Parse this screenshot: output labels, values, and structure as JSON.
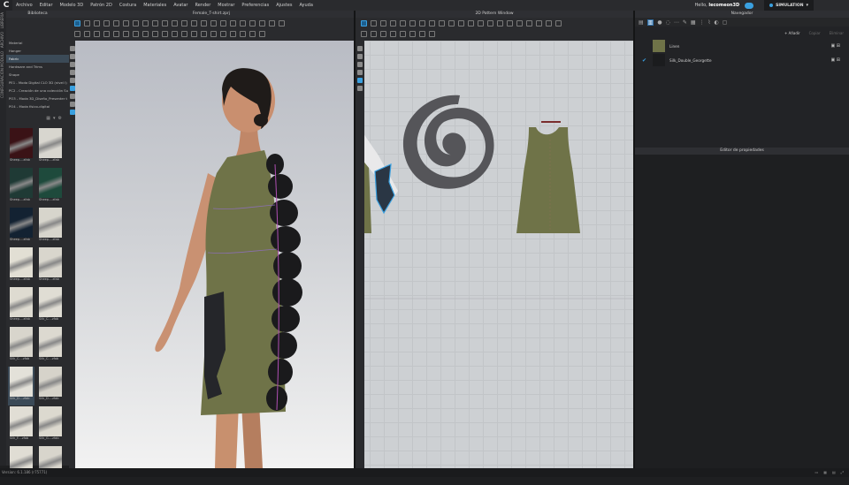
{
  "menubar": {
    "logo": "C",
    "items": [
      "Archivo",
      "Editar",
      "Modelo 3D",
      "Patrón 2D",
      "Costura",
      "Materiales",
      "Avatar",
      "Render",
      "Mostrar",
      "Preferencias",
      "Ajustes",
      "Ayuda"
    ],
    "user_prefix": "Hello,",
    "user_name": "lecomeon3D",
    "mode": "SIMULATION"
  },
  "vertical_tabs": [
    "LIBRERÍA",
    "ARCHIVO",
    "CONFIGURACIÓN MÓDULO"
  ],
  "library": {
    "title": "Biblioteca",
    "folders": [
      {
        "label": "Material",
        "selected": false
      },
      {
        "label": "Hanger",
        "selected": false
      },
      {
        "label": "Fabric",
        "selected": true
      },
      {
        "label": "Hardware and Trims",
        "selected": false
      },
      {
        "label": "Shape",
        "selected": false
      },
      {
        "label": "PE1 - Moda Digital CLO 3D (nivel I)",
        "selected": false
      },
      {
        "label": "PC2 - Creación de una colección Su",
        "selected": false
      },
      {
        "label": "PO3 - Moda 3D_Diseño_Presenter t",
        "selected": false
      },
      {
        "label": "PO4 - Moda físico-digital",
        "selected": false
      }
    ],
    "thumbnails": [
      {
        "label": "Sheep....zfab",
        "color": "#3a1216",
        "selected": false
      },
      {
        "label": "Sheep....zfab",
        "color": "#d8d6cf",
        "selected": false
      },
      {
        "label": "Sheep....zfab",
        "color": "#1f3a35",
        "selected": false
      },
      {
        "label": "Sheep....zfab",
        "color": "#1e4a3c",
        "selected": false
      },
      {
        "label": "Sheep....zfab",
        "color": "#132232",
        "selected": false
      },
      {
        "label": "Sheep....zfab",
        "color": "#d7d5cc",
        "selected": false
      },
      {
        "label": "Sheep....zfab",
        "color": "#e2dfd4",
        "selected": false
      },
      {
        "label": "Sheep....zfab",
        "color": "#d9d6cd",
        "selected": false
      },
      {
        "label": "Sheep....zfab",
        "color": "#dedbd1",
        "selected": false
      },
      {
        "label": "Silk_C....zfab",
        "color": "#e0ddd4",
        "selected": false
      },
      {
        "label": "Silk_C....zfab",
        "color": "#d8d5cc",
        "selected": false
      },
      {
        "label": "Silk_C....zfab",
        "color": "#dcd9d0",
        "selected": false
      },
      {
        "label": "Silk_D....zfab",
        "color": "#e3e1d9",
        "selected": true
      },
      {
        "label": "Silk_D....zfab",
        "color": "#d6d3ca",
        "selected": false
      },
      {
        "label": "Silk_F....zfab",
        "color": "#e1ded5",
        "selected": false
      },
      {
        "label": "Silk_G....zfab",
        "color": "#dcd9cf",
        "selected": false
      },
      {
        "label": "",
        "color": "#e0ddd4",
        "selected": false
      },
      {
        "label": "",
        "color": "#d8d5cc",
        "selected": false
      }
    ]
  },
  "view3d": {
    "title": "Female_T-shirt.zprj"
  },
  "view2d": {
    "title": "2D Pattern Window"
  },
  "navigator": {
    "title": "Navegador",
    "add_label": "+ Añadir",
    "copy_label": "Copiar",
    "delete_label": "Eliminar",
    "fabrics": [
      {
        "name": "Linen",
        "color": "#6f7348",
        "checked": false
      },
      {
        "name": "Silk_Double_Georgette",
        "color": "#1b1c1e",
        "checked": true
      }
    ]
  },
  "properties": {
    "title": "Editor de propiedades"
  },
  "status": {
    "version": "Version: 6.1.186 (r75771)"
  },
  "colors": {
    "accent": "#3aa0e0",
    "dress": "#6f7348",
    "ruffle": "#1a1a1c"
  }
}
